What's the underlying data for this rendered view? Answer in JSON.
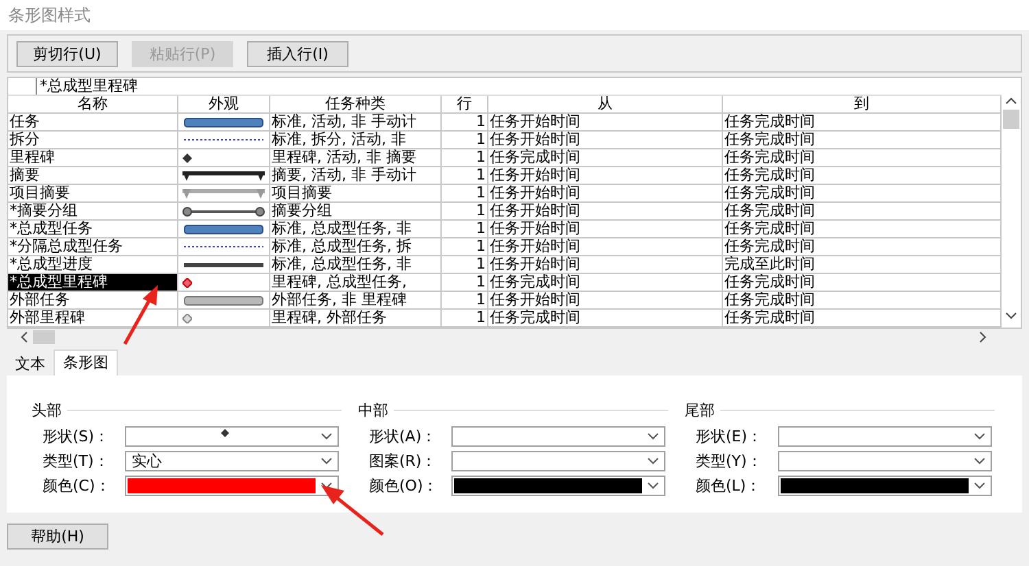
{
  "window": {
    "title": "条形图样式"
  },
  "toolbar": [
    {
      "label": "剪切行(U)",
      "disabled": false
    },
    {
      "label": "粘贴行(P)",
      "disabled": true
    },
    {
      "label": "插入行(I)",
      "disabled": false
    }
  ],
  "edit_value": "*总成型里程碑",
  "table": {
    "columns": [
      "名称",
      "外观",
      "任务种类",
      "行",
      "从",
      "到"
    ],
    "rows": [
      {
        "name": "任务",
        "kind": "task",
        "type": "标准, 活动, 非  手动计",
        "row": "1",
        "from": "任务开始时间",
        "to": "任务完成时间",
        "selected": false
      },
      {
        "name": "拆分",
        "kind": "split",
        "type": "标准, 拆分, 活动, 非",
        "row": "1",
        "from": "任务开始时间",
        "to": "任务完成时间",
        "selected": false
      },
      {
        "name": "里程碑",
        "kind": "milestone",
        "type": "里程碑, 活动, 非  摘要",
        "row": "1",
        "from": "任务完成时间",
        "to": "任务完成时间",
        "selected": false
      },
      {
        "name": "摘要",
        "kind": "summary",
        "type": "摘要, 活动, 非  手动计",
        "row": "1",
        "from": "任务开始时间",
        "to": "任务完成时间",
        "selected": false
      },
      {
        "name": "项目摘要",
        "kind": "project-summary",
        "type": "项目摘要",
        "row": "1",
        "from": "任务开始时间",
        "to": "任务完成时间",
        "selected": false
      },
      {
        "name": "*摘要分组",
        "kind": "summary-group",
        "type": "摘要分组",
        "row": "1",
        "from": "任务开始时间",
        "to": "任务完成时间",
        "selected": false
      },
      {
        "name": "*总成型任务",
        "kind": "task",
        "type": "标准, 总成型任务, 非",
        "row": "1",
        "from": "任务开始时间",
        "to": "任务完成时间",
        "selected": false
      },
      {
        "name": "*分隔总成型任务",
        "kind": "split",
        "type": "标准, 总成型任务, 拆",
        "row": "1",
        "from": "任务开始时间",
        "to": "任务完成时间",
        "selected": false
      },
      {
        "name": "*总成型进度",
        "kind": "progress",
        "type": "标准, 总成型任务, 非",
        "row": "1",
        "from": "任务开始时间",
        "to": "完成至此时间",
        "selected": false
      },
      {
        "name": "*总成型里程碑",
        "kind": "rollup-milestone",
        "type": "里程碑, 总成型任务,",
        "row": "1",
        "from": "任务完成时间",
        "to": "任务完成时间",
        "selected": true
      },
      {
        "name": "外部任务",
        "kind": "external-task",
        "type": "外部任务, 非  里程碑",
        "row": "1",
        "from": "任务开始时间",
        "to": "任务完成时间",
        "selected": false
      },
      {
        "name": "外部里程碑",
        "kind": "external-milestone",
        "type": "里程碑, 外部任务",
        "row": "1",
        "from": "任务完成时间",
        "to": "任务完成时间",
        "selected": false
      }
    ]
  },
  "tabs": [
    {
      "label": "文本",
      "selected": false
    },
    {
      "label": "条形图",
      "selected": true
    }
  ],
  "groups": [
    {
      "title": "头部",
      "fields": [
        {
          "label": "形状(S)：",
          "kind": "diamond"
        },
        {
          "label": "类型(T)：",
          "value": "实心"
        },
        {
          "label": "颜色(C)：",
          "color": "#ff0000"
        }
      ]
    },
    {
      "title": "中部",
      "fields": [
        {
          "label": "形状(A)："
        },
        {
          "label": "图案(R)："
        },
        {
          "label": "颜色(O)：",
          "color": "#000000"
        }
      ]
    },
    {
      "title": "尾部",
      "fields": [
        {
          "label": "形状(E)："
        },
        {
          "label": "类型(Y)："
        },
        {
          "label": "颜色(L)：",
          "color": "#000000"
        }
      ]
    }
  ],
  "help_button": "帮助(H)"
}
